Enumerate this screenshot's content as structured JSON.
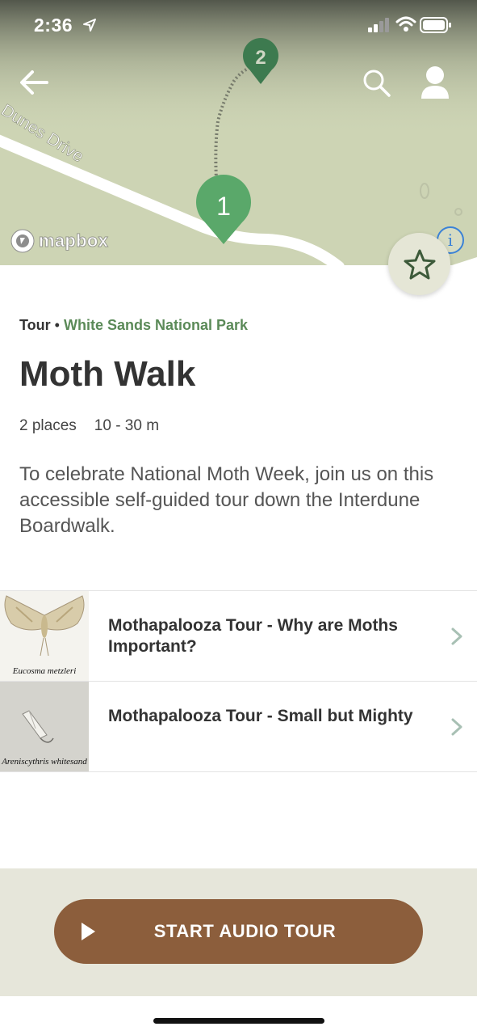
{
  "status_bar": {
    "time": "2:36"
  },
  "map": {
    "road_label": "Dunes Drive",
    "markers": [
      {
        "number": "1",
        "color": "#5aa86a"
      },
      {
        "number": "2",
        "color": "#3d7a4f"
      }
    ],
    "attribution": "mapbox",
    "info_label": "i"
  },
  "icons": {
    "back": "back-arrow-icon",
    "search": "search-icon",
    "profile": "user-icon",
    "favorite": "star-icon",
    "play": "play-icon",
    "chevron": "chevron-right-icon"
  },
  "tour": {
    "type_label": "Tour",
    "separator": "•",
    "park": "White Sands National Park",
    "title": "Moth Walk",
    "places": "2 places",
    "duration": "10 - 30 m",
    "description": "To celebrate National Moth Week, join us on this accessible self-guided tour down the Interdune Boardwalk."
  },
  "stops": [
    {
      "title": "Mothapalooza Tour - Why are Moths Important?",
      "image_caption": "Eucosma metzleri"
    },
    {
      "title": "Mothapalooza Tour - Small but Mighty",
      "image_caption": "Areniscythris whitesand"
    }
  ],
  "action": {
    "start_label": "START AUDIO TOUR"
  },
  "colors": {
    "accent_green": "#5b8a58",
    "button_brown": "#8c5e3c",
    "bottom_bar": "#e6e6da",
    "favorite_bg": "#e5e6d6",
    "map_bg": "#cfd6b8"
  }
}
